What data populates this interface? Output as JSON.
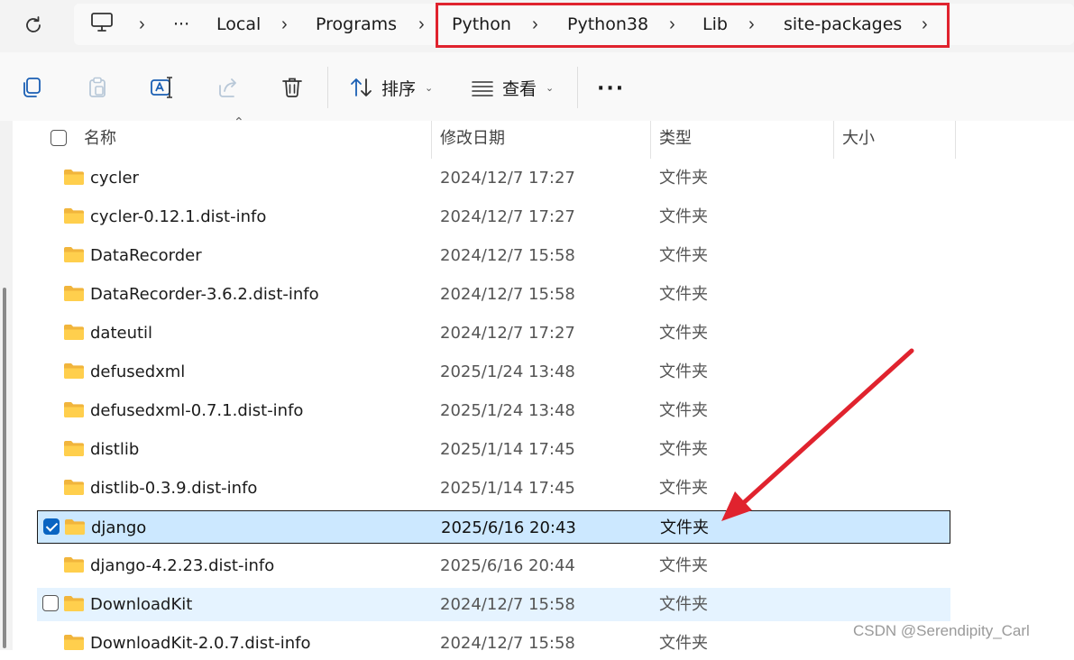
{
  "address_bar": {
    "refresh_icon": "refresh-icon",
    "pc_icon": "monitor-icon",
    "ellipsis": "···",
    "segments": [
      "Local",
      "Programs",
      "Python",
      "Python38",
      "Lib",
      "site-packages"
    ],
    "separator": "›",
    "highlight_color": "#e0232e"
  },
  "toolbar": {
    "icons": [
      "copy-icon",
      "paste-icon",
      "rename-icon",
      "share-icon",
      "delete-icon"
    ],
    "sort_label": "排序",
    "view_label": "查看",
    "more_label": "···"
  },
  "columns": {
    "name": "名称",
    "modified": "修改日期",
    "type": "类型",
    "size": "大小"
  },
  "files": [
    {
      "name": "cycler",
      "modified": "2024/12/7 17:27",
      "type": "文件夹",
      "state": "normal"
    },
    {
      "name": "cycler-0.12.1.dist-info",
      "modified": "2024/12/7 17:27",
      "type": "文件夹",
      "state": "normal"
    },
    {
      "name": "DataRecorder",
      "modified": "2024/12/7 15:58",
      "type": "文件夹",
      "state": "normal"
    },
    {
      "name": "DataRecorder-3.6.2.dist-info",
      "modified": "2024/12/7 15:58",
      "type": "文件夹",
      "state": "normal"
    },
    {
      "name": "dateutil",
      "modified": "2024/12/7 17:27",
      "type": "文件夹",
      "state": "normal"
    },
    {
      "name": "defusedxml",
      "modified": "2025/1/24 13:48",
      "type": "文件夹",
      "state": "normal"
    },
    {
      "name": "defusedxml-0.7.1.dist-info",
      "modified": "2025/1/24 13:48",
      "type": "文件夹",
      "state": "normal"
    },
    {
      "name": "distlib",
      "modified": "2025/1/14 17:45",
      "type": "文件夹",
      "state": "normal"
    },
    {
      "name": "distlib-0.3.9.dist-info",
      "modified": "2025/1/14 17:45",
      "type": "文件夹",
      "state": "normal"
    },
    {
      "name": "django",
      "modified": "2025/6/16 20:43",
      "type": "文件夹",
      "state": "selected"
    },
    {
      "name": "django-4.2.23.dist-info",
      "modified": "2025/6/16 20:44",
      "type": "文件夹",
      "state": "normal"
    },
    {
      "name": "DownloadKit",
      "modified": "2024/12/7 15:58",
      "type": "文件夹",
      "state": "hover"
    },
    {
      "name": "DownloadKit-2.0.7.dist-info",
      "modified": "2024/12/7 15:58",
      "type": "文件夹",
      "state": "normal"
    }
  ],
  "annotation": {
    "arrow_color": "#e0232e",
    "points_to": "django"
  },
  "watermark": "CSDN @Serendipity_Carl"
}
